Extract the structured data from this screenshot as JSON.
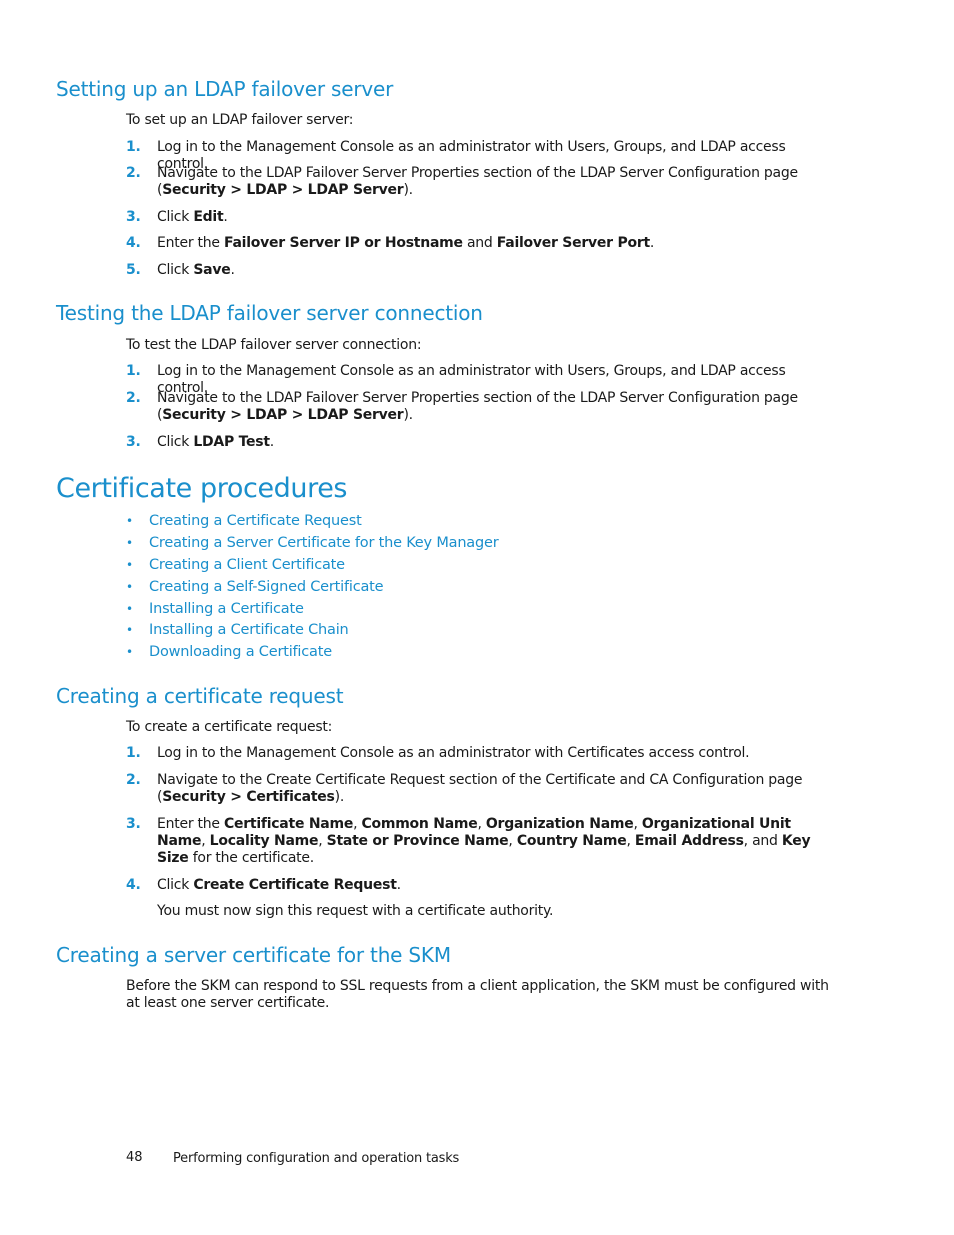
{
  "accent_color": "#1a8fcc",
  "sections": {
    "ldap_failover": {
      "title": "Setting up an LDAP failover server",
      "intro": "To set up an LDAP failover server:",
      "steps": [
        {
          "num": "1.",
          "parts": [
            {
              "t": "Log in to the Management Console as an administrator with Users, Groups, and LDAP access control."
            }
          ]
        },
        {
          "num": "2.",
          "parts": [
            {
              "t": "Navigate to the LDAP Failover Server Properties section of the LDAP Server Configuration page ("
            },
            {
              "t": "Security > LDAP > LDAP Server",
              "b": true
            },
            {
              "t": ")."
            }
          ]
        },
        {
          "num": "3.",
          "parts": [
            {
              "t": "Click "
            },
            {
              "t": "Edit",
              "b": true
            },
            {
              "t": "."
            }
          ]
        },
        {
          "num": "4.",
          "parts": [
            {
              "t": "Enter the "
            },
            {
              "t": "Failover Server IP or Hostname",
              "b": true
            },
            {
              "t": " and "
            },
            {
              "t": "Failover Server Port",
              "b": true
            },
            {
              "t": "."
            }
          ]
        },
        {
          "num": "5.",
          "parts": [
            {
              "t": "Click "
            },
            {
              "t": "Save",
              "b": true
            },
            {
              "t": "."
            }
          ]
        }
      ]
    },
    "ldap_test": {
      "title": "Testing the LDAP failover server connection",
      "intro": "To test the LDAP failover server connection:",
      "steps": [
        {
          "num": "1.",
          "parts": [
            {
              "t": "Log in to the Management Console as an administrator with Users, Groups, and LDAP access control."
            }
          ]
        },
        {
          "num": "2.",
          "parts": [
            {
              "t": "Navigate to the LDAP Failover Server Properties section of the LDAP Server Configuration page ("
            },
            {
              "t": "Security > LDAP > LDAP Server",
              "b": true
            },
            {
              "t": ")."
            }
          ]
        },
        {
          "num": "3.",
          "parts": [
            {
              "t": "Click "
            },
            {
              "t": "LDAP Test",
              "b": true
            },
            {
              "t": "."
            }
          ]
        }
      ]
    },
    "cert_procedures": {
      "title": "Certificate procedures",
      "links": [
        "Creating a Certificate Request",
        "Creating a Server Certificate for the Key Manager",
        "Creating a Client Certificate",
        "Creating a Self-Signed Certificate",
        "Installing a Certificate",
        "Installing a Certificate Chain",
        "Downloading a Certificate"
      ]
    },
    "cert_request": {
      "title": "Creating a certificate request",
      "intro": "To create a certificate request:",
      "steps": [
        {
          "num": "1.",
          "parts": [
            {
              "t": "Log in to the Management Console as an administrator with Certificates access control."
            }
          ]
        },
        {
          "num": "2.",
          "parts": [
            {
              "t": "Navigate to the Create Certificate Request section of the Certificate and CA Configuration page ("
            },
            {
              "t": "Security > Certificates",
              "b": true
            },
            {
              "t": ")."
            }
          ]
        },
        {
          "num": "3.",
          "parts": [
            {
              "t": "Enter the "
            },
            {
              "t": "Certificate Name",
              "b": true
            },
            {
              "t": ", "
            },
            {
              "t": "Common Name",
              "b": true
            },
            {
              "t": ", "
            },
            {
              "t": "Organization Name",
              "b": true
            },
            {
              "t": ", "
            },
            {
              "t": "Organizational Unit Name",
              "b": true
            },
            {
              "t": ", "
            },
            {
              "t": "Locality Name",
              "b": true
            },
            {
              "t": ", "
            },
            {
              "t": "State or Province Name",
              "b": true
            },
            {
              "t": ", "
            },
            {
              "t": "Country Name",
              "b": true
            },
            {
              "t": ", "
            },
            {
              "t": "Email Address",
              "b": true
            },
            {
              "t": ", and "
            },
            {
              "t": "Key Size",
              "b": true
            },
            {
              "t": " for the certificate."
            }
          ]
        },
        {
          "num": "4.",
          "parts": [
            {
              "t": "Click "
            },
            {
              "t": "Create Certificate Request",
              "b": true
            },
            {
              "t": "."
            }
          ]
        }
      ],
      "note": "You must now sign this request with a certificate authority."
    },
    "server_cert": {
      "title": "Creating a server certificate for the SKM",
      "body": "Before the SKM can respond to SSL requests from a client application, the SKM must be configured with at least one server certificate."
    }
  },
  "footer": {
    "page_number": "48",
    "chapter_title": "Performing configuration and operation tasks"
  }
}
